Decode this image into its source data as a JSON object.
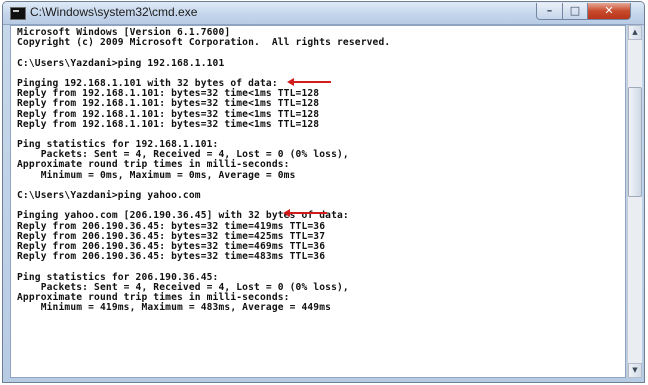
{
  "window": {
    "title": "C:\\Windows\\system32\\cmd.exe",
    "buttons": {
      "minimize": "–",
      "maximize": "□",
      "close": "✕"
    }
  },
  "console": {
    "lines": [
      "Microsoft Windows [Version 6.1.7600]",
      "Copyright (c) 2009 Microsoft Corporation.  All rights reserved.",
      "",
      "C:\\Users\\Yazdani>ping 192.168.1.101",
      "",
      "Pinging 192.168.1.101 with 32 bytes of data:",
      "Reply from 192.168.1.101: bytes=32 time<1ms TTL=128",
      "Reply from 192.168.1.101: bytes=32 time<1ms TTL=128",
      "Reply from 192.168.1.101: bytes=32 time<1ms TTL=128",
      "Reply from 192.168.1.101: bytes=32 time<1ms TTL=128",
      "",
      "Ping statistics for 192.168.1.101:",
      "    Packets: Sent = 4, Received = 4, Lost = 0 (0% loss),",
      "Approximate round trip times in milli-seconds:",
      "    Minimum = 0ms, Maximum = 0ms, Average = 0ms",
      "",
      "C:\\Users\\Yazdani>ping yahoo.com",
      "",
      "Pinging yahoo.com [206.190.36.45] with 32 bytes of data:",
      "Reply from 206.190.36.45: bytes=32 time=419ms TTL=36",
      "Reply from 206.190.36.45: bytes=32 time=425ms TTL=37",
      "Reply from 206.190.36.45: bytes=32 time=469ms TTL=36",
      "Reply from 206.190.36.45: bytes=32 time=483ms TTL=36",
      "",
      "Ping statistics for 206.190.36.45:",
      "    Packets: Sent = 4, Received = 4, Lost = 0 (0% loss),",
      "Approximate round trip times in milli-seconds:",
      "    Minimum = 419ms, Maximum = 483ms, Average = 449ms"
    ]
  },
  "colors": {
    "arrow": "#d21b1b",
    "console_text": "#111111",
    "console_background": "#ffffff"
  },
  "icons": [
    "cmd-app-icon",
    "arrow-left-icon",
    "scroll-up-icon",
    "scroll-down-icon"
  ]
}
